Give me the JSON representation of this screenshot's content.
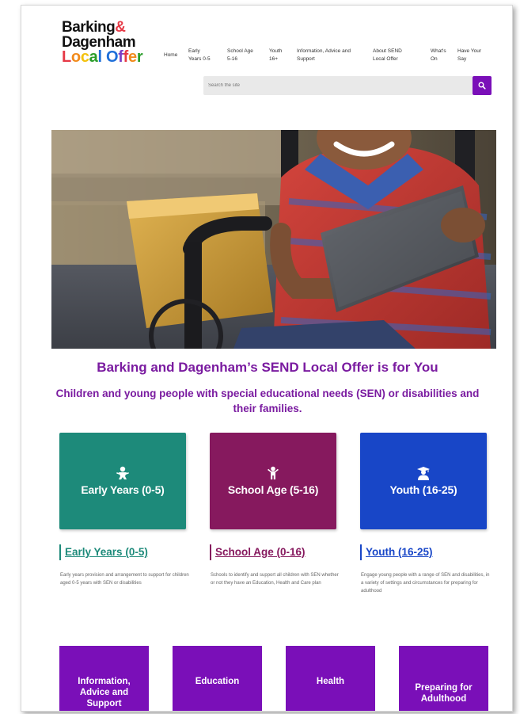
{
  "logo": {
    "line1": "Barking",
    "amp": "&",
    "line2": "Dagenham",
    "line3_letters": [
      "L",
      "o",
      "c",
      "a",
      "l",
      " ",
      "O",
      "f",
      "f",
      "e",
      "r"
    ]
  },
  "nav": [
    {
      "label": "Home"
    },
    {
      "label": "Early\nYears 0-5"
    },
    {
      "label": "School Age\n5-16"
    },
    {
      "label": "Youth\n16+"
    },
    {
      "label": "Information, Advice and\nSupport"
    },
    {
      "label": "About SEND\nLocal Offer"
    },
    {
      "label": "What's\nOn"
    },
    {
      "label": "Have Your\nSay"
    }
  ],
  "search": {
    "placeholder": "Search the site"
  },
  "hero": {
    "title": "Barking and Dagenham’s SEND Local Offer is for You",
    "subtitle": "Children and young people with special educational needs (SEN) or disabilities and their families."
  },
  "tiles": [
    {
      "label": "Early Years (0-5)",
      "icon": "baby-icon",
      "color": "#1d8a7a"
    },
    {
      "label": "School Age (5-16)",
      "icon": "child-icon",
      "color": "#86195e"
    },
    {
      "label": "Youth (16-25)",
      "icon": "graduate-icon",
      "color": "#1846c7"
    }
  ],
  "links": [
    {
      "heading": "Early Years (0-5)",
      "desc": "Early years provision and arrangement to support for children aged 0-5 years with SEN or disabilities",
      "color": "#1d8a7a"
    },
    {
      "heading": "School Age (0-16)",
      "desc": "Schools to identify and support all children with SEN whether or not they have an Education, Health and Care plan",
      "color": "#86195e"
    },
    {
      "heading": "Youth (16-25)",
      "desc": "Engage young people with a range of SEN and disabilities, in a variety of settings and circumstances for preparing for adulthood",
      "color": "#1846c7"
    }
  ],
  "bottom_tiles": [
    {
      "label": "Information, Advice and Support"
    },
    {
      "label": "Education"
    },
    {
      "label": "Health"
    },
    {
      "label": "Preparing for Adulthood"
    }
  ],
  "colors": {
    "brand_purple": "#7a0fb8",
    "heading_purple": "#7a1ba0",
    "logo_letters": [
      "#e63946",
      "#f18a1b",
      "#f4c20d",
      "#2a9d2a",
      "#1e6fd9",
      "#ffffff",
      "#1e6fd9",
      "#7a3fc7",
      "#e63946",
      "#f18a1b",
      "#2a9d2a"
    ]
  }
}
